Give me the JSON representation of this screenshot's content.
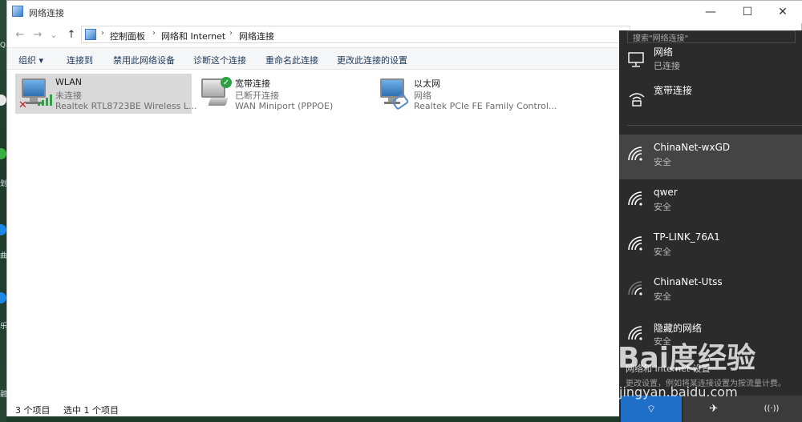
{
  "window": {
    "title": "网络连接",
    "minimize": "—",
    "maximize": "☐",
    "close": "✕"
  },
  "address": {
    "back": "←",
    "forward": "→",
    "recent": "⌄",
    "up": "↑",
    "crumbs": [
      "控制面板",
      "网络和 Internet",
      "网络连接"
    ],
    "search_placeholder": "搜索\"网络连接\""
  },
  "commands": {
    "organize": "组织 ▾",
    "connect_to": "连接到",
    "disable_device": "禁用此网络设备",
    "diagnose": "诊断这个连接",
    "rename": "重命名此连接",
    "change_settings": "更改此连接的设置"
  },
  "connections": [
    {
      "name": "WLAN",
      "status": "未连接",
      "device": "Realtek RTL8723BE Wireless L..."
    },
    {
      "name": "宽带连接",
      "status": "已断开连接",
      "device": "WAN Miniport (PPPOE)"
    },
    {
      "name": "以太网",
      "status": "网络",
      "device": "Realtek PCIe FE Family Control..."
    }
  ],
  "statusbar": {
    "items_count": "3 个项目",
    "selected_count": "选中 1 个项目"
  },
  "flyout": {
    "network": {
      "title": "网络",
      "sub": "已连接"
    },
    "broadband": {
      "title": "宽带连接"
    },
    "wifi": [
      {
        "ssid": "ChinaNet-wxGD",
        "security": "安全"
      },
      {
        "ssid": "qwer",
        "security": "安全"
      },
      {
        "ssid": "TP-LINK_76A1",
        "security": "安全"
      },
      {
        "ssid": "ChinaNet-Utss",
        "security": "安全"
      },
      {
        "ssid": "隐藏的网络",
        "security": "安全"
      }
    ],
    "settings_link": "网络和 Internet 设置",
    "settings_desc": "更改设置，例如将某连接设置为按流量计费。",
    "tiles": {
      "wlan": "⌔",
      "airplane": "✈",
      "hotspot": "((·))"
    }
  },
  "watermark": {
    "logo": "Bai度经验",
    "url": "jingyan.baidu.com"
  },
  "desktop": {
    "labels": [
      "Q",
      "划",
      "曲",
      "乐",
      "碧"
    ]
  }
}
